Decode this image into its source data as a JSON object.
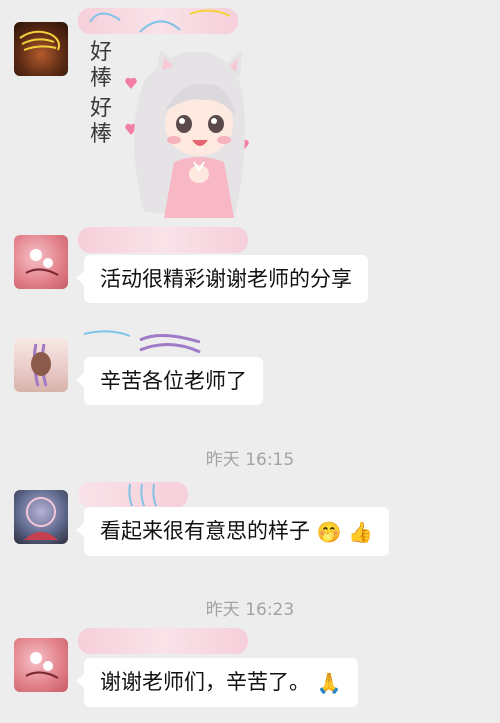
{
  "messages": [
    {
      "type": "sticker",
      "sticker": {
        "text_top": "好棒",
        "text_bottom": "好棒"
      }
    },
    {
      "type": "text",
      "text": "活动很精彩谢谢老师的分享"
    },
    {
      "type": "text",
      "text": "辛苦各位老师了"
    },
    {
      "type": "timestamp",
      "text": "昨天 16:15"
    },
    {
      "type": "text",
      "text": "看起来很有意思的样子",
      "emojis": [
        "🤭",
        "👍"
      ]
    },
    {
      "type": "timestamp",
      "text": "昨天 16:23"
    },
    {
      "type": "text",
      "text": "谢谢老师们，辛苦了。",
      "emojis": [
        "🙏"
      ]
    }
  ],
  "colors": {
    "background": "#ededed",
    "bubble": "#ffffff",
    "timestamp": "#a3a3a3",
    "scribble_pink": "#f6b7c8",
    "scribble_blue": "#7fc3e8",
    "scribble_yellow": "#f2d23c"
  },
  "icons": [
    "avatar",
    "sticker-girl"
  ]
}
